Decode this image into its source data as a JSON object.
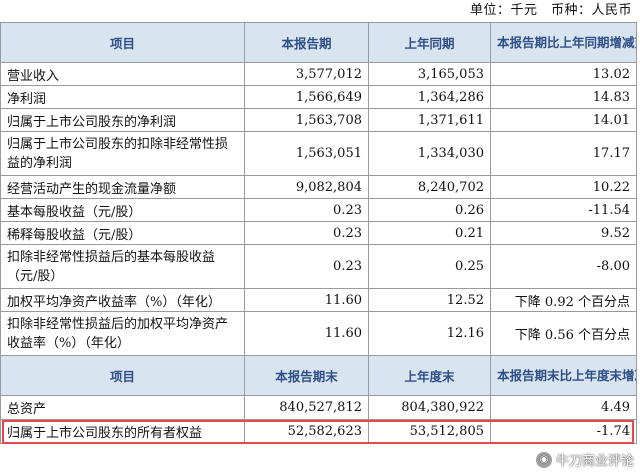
{
  "unit_line": "单位：千元　币种：人民币",
  "section1": {
    "headers": [
      "项目",
      "本报告期",
      "上年同期",
      "本报告期比上年同期增减变动幅度(%)"
    ],
    "rows": [
      [
        "营业收入",
        "3,577,012",
        "3,165,053",
        "13.02"
      ],
      [
        "净利润",
        "1,566,649",
        "1,364,286",
        "14.83"
      ],
      [
        "归属于上市公司股东的净利润",
        "1,563,708",
        "1,371,611",
        "14.01"
      ],
      [
        "归属于上市公司股东的扣除非经常性损益的净利润",
        "1,563,051",
        "1,334,030",
        "17.17"
      ],
      [
        "经营活动产生的现金流量净额",
        "9,082,804",
        "8,240,702",
        "10.22"
      ],
      [
        "基本每股收益（元/股）",
        "0.23",
        "0.26",
        "-11.54"
      ],
      [
        "稀释每股收益（元/股）",
        "0.23",
        "0.21",
        "9.52"
      ],
      [
        "扣除非经常性损益后的基本每股收益（元/股）",
        "0.23",
        "0.25",
        "-8.00"
      ],
      [
        "加权平均净资产收益率（%）（年化）",
        "11.60",
        "12.52",
        "下降 0.92 个百分点"
      ],
      [
        "扣除非经常性损益后的加权平均净资产收益率（%）（年化）",
        "11.60",
        "12.16",
        "下降 0.56 个百分点"
      ]
    ]
  },
  "section2": {
    "headers": [
      "项目",
      "本报告期末",
      "上年度末",
      "本报告期末比上年度末增减变动幅度(%)"
    ],
    "rows": [
      [
        "总资产",
        "840,527,812",
        "804,380,922",
        "4.49"
      ],
      [
        "归属于上市公司股东的所有者权益",
        "52,582,623",
        "53,512,805",
        "-1.74"
      ]
    ]
  },
  "watermark": "牛刀商业评论",
  "colors": {
    "header_bg": "#d9e4f1",
    "header_text": "#2f4f87",
    "highlight": "#e5474b"
  }
}
